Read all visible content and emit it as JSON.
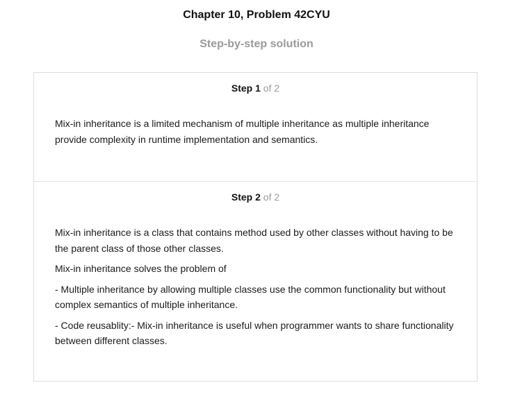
{
  "header": {
    "title": "Chapter 10, Problem 42CYU",
    "subtitle": "Step-by-step solution"
  },
  "steps": [
    {
      "label": "Step",
      "number": "1",
      "of_text": "of 2",
      "paragraphs": [
        "Mix-in inheritance is a limited mechanism of multiple inheritance as multiple inheritance provide complexity in runtime implementation and semantics."
      ]
    },
    {
      "label": "Step",
      "number": "2",
      "of_text": "of 2",
      "paragraphs": [
        "Mix-in inheritance is a class that contains method used by other classes without having to be the parent class of those other classes.",
        "Mix-in inheritance solves the problem of",
        "- Multiple inheritance by allowing multiple classes use the common functionality but without complex semantics of multiple inheritance.",
        "- Code reusablity:- Mix-in inheritance is useful when programmer wants to share functionality between different classes."
      ]
    }
  ],
  "colors": {
    "title": "#111111",
    "muted": "#9a9a9a",
    "border": "#dddddd",
    "text": "#1a1a1a"
  }
}
